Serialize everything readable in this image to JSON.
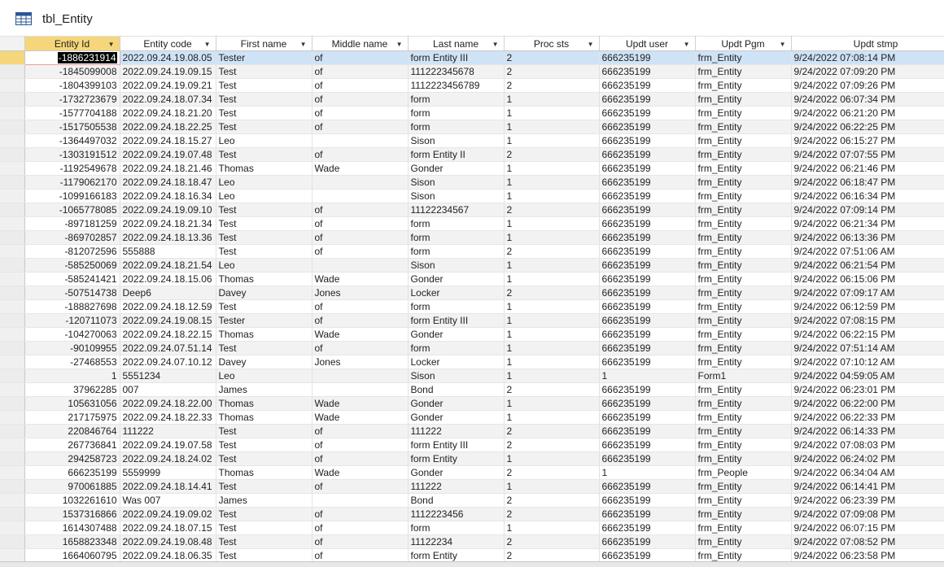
{
  "tab": {
    "title": "tbl_Entity",
    "icon": "table-icon"
  },
  "columns": [
    {
      "key": "id",
      "label": "Entity Id",
      "sorted": true
    },
    {
      "key": "code",
      "label": "Entity code"
    },
    {
      "key": "first",
      "label": "First name"
    },
    {
      "key": "middle",
      "label": "Middle name"
    },
    {
      "key": "last",
      "label": "Last name"
    },
    {
      "key": "sts",
      "label": "Proc sts"
    },
    {
      "key": "user",
      "label": "Updt user"
    },
    {
      "key": "pgm",
      "label": "Updt Pgm"
    },
    {
      "key": "stmp",
      "label": "Updt stmp",
      "noArrow": true
    }
  ],
  "rows": [
    [
      "-1886231914",
      "2022.09.24.19.08.05",
      "Tester",
      "of",
      "form Entity III",
      "2",
      "666235199",
      "frm_Entity",
      "9/24/2022 07:08:14 PM"
    ],
    [
      "-1845099008",
      "2022.09.24.19.09.15",
      "Test",
      "of",
      "111222345678",
      "2",
      "666235199",
      "frm_Entity",
      "9/24/2022 07:09:20 PM"
    ],
    [
      "-1804399103",
      "2022.09.24.19.09.21",
      "Test",
      "of",
      "1112223456789",
      "2",
      "666235199",
      "frm_Entity",
      "9/24/2022 07:09:26 PM"
    ],
    [
      "-1732723679",
      "2022.09.24.18.07.34",
      "Test",
      "of",
      "form",
      "1",
      "666235199",
      "frm_Entity",
      "9/24/2022 06:07:34 PM"
    ],
    [
      "-1577704188",
      "2022.09.24.18.21.20",
      "Test",
      "of",
      "form",
      "1",
      "666235199",
      "frm_Entity",
      "9/24/2022 06:21:20 PM"
    ],
    [
      "-1517505538",
      "2022.09.24.18.22.25",
      "Test",
      "of",
      "form",
      "1",
      "666235199",
      "frm_Entity",
      "9/24/2022 06:22:25 PM"
    ],
    [
      "-1364497032",
      "2022.09.24.18.15.27",
      "Leo",
      "",
      "Sison",
      "1",
      "666235199",
      "frm_Entity",
      "9/24/2022 06:15:27 PM"
    ],
    [
      "-1303191512",
      "2022.09.24.19.07.48",
      "Test",
      "of",
      "form Entity II",
      "2",
      "666235199",
      "frm_Entity",
      "9/24/2022 07:07:55 PM"
    ],
    [
      "-1192549678",
      "2022.09.24.18.21.46",
      "Thomas",
      "Wade",
      "Gonder",
      "1",
      "666235199",
      "frm_Entity",
      "9/24/2022 06:21:46 PM"
    ],
    [
      "-1179062170",
      "2022.09.24.18.18.47",
      "Leo",
      "",
      "Sison",
      "1",
      "666235199",
      "frm_Entity",
      "9/24/2022 06:18:47 PM"
    ],
    [
      "-1099166183",
      "2022.09.24.18.16.34",
      "Leo",
      "",
      "Sison",
      "1",
      "666235199",
      "frm_Entity",
      "9/24/2022 06:16:34 PM"
    ],
    [
      "-1065778085",
      "2022.09.24.19.09.10",
      "Test",
      "of",
      "11122234567",
      "2",
      "666235199",
      "frm_Entity",
      "9/24/2022 07:09:14 PM"
    ],
    [
      "-897181259",
      "2022.09.24.18.21.34",
      "Test",
      "of",
      "form",
      "1",
      "666235199",
      "frm_Entity",
      "9/24/2022 06:21:34 PM"
    ],
    [
      "-869702857",
      "2022.09.24.18.13.36",
      "Test",
      "of",
      "form",
      "1",
      "666235199",
      "frm_Entity",
      "9/24/2022 06:13:36 PM"
    ],
    [
      "-812072596",
      "555888",
      "Test",
      "of",
      "form",
      "2",
      "666235199",
      "frm_Entity",
      "9/24/2022 07:51:06 AM"
    ],
    [
      "-585250069",
      "2022.09.24.18.21.54",
      "Leo",
      "",
      "Sison",
      "1",
      "666235199",
      "frm_Entity",
      "9/24/2022 06:21:54 PM"
    ],
    [
      "-585241421",
      "2022.09.24.18.15.06",
      "Thomas",
      "Wade",
      "Gonder",
      "1",
      "666235199",
      "frm_Entity",
      "9/24/2022 06:15:06 PM"
    ],
    [
      "-507514738",
      "Deep6",
      "Davey",
      "Jones",
      "Locker",
      "2",
      "666235199",
      "frm_Entity",
      "9/24/2022 07:09:17 AM"
    ],
    [
      "-188827698",
      "2022.09.24.18.12.59",
      "Test",
      "of",
      "form",
      "1",
      "666235199",
      "frm_Entity",
      "9/24/2022 06:12:59 PM"
    ],
    [
      "-120711073",
      "2022.09.24.19.08.15",
      "Tester",
      "of",
      "form Entity III",
      "1",
      "666235199",
      "frm_Entity",
      "9/24/2022 07:08:15 PM"
    ],
    [
      "-104270063",
      "2022.09.24.18.22.15",
      "Thomas",
      "Wade",
      "Gonder",
      "1",
      "666235199",
      "frm_Entity",
      "9/24/2022 06:22:15 PM"
    ],
    [
      "-90109955",
      "2022.09.24.07.51.14",
      "Test",
      "of",
      "form",
      "1",
      "666235199",
      "frm_Entity",
      "9/24/2022 07:51:14 AM"
    ],
    [
      "-27468553",
      "2022.09.24.07.10.12",
      "Davey",
      "Jones",
      "Locker",
      "1",
      "666235199",
      "frm_Entity",
      "9/24/2022 07:10:12 AM"
    ],
    [
      "1",
      "5551234",
      "Leo",
      "",
      "Sison",
      "1",
      "1",
      "Form1",
      "9/24/2022 04:59:05 AM"
    ],
    [
      "37962285",
      "007",
      "James",
      "",
      "Bond",
      "2",
      "666235199",
      "frm_Entity",
      "9/24/2022 06:23:01 PM"
    ],
    [
      "105631056",
      "2022.09.24.18.22.00",
      "Thomas",
      "Wade",
      "Gonder",
      "1",
      "666235199",
      "frm_Entity",
      "9/24/2022 06:22:00 PM"
    ],
    [
      "217175975",
      "2022.09.24.18.22.33",
      "Thomas",
      "Wade",
      "Gonder",
      "1",
      "666235199",
      "frm_Entity",
      "9/24/2022 06:22:33 PM"
    ],
    [
      "220846764",
      "111222",
      "Test",
      "of",
      "111222",
      "2",
      "666235199",
      "frm_Entity",
      "9/24/2022 06:14:33 PM"
    ],
    [
      "267736841",
      "2022.09.24.19.07.58",
      "Test",
      "of",
      "form Entity III",
      "2",
      "666235199",
      "frm_Entity",
      "9/24/2022 07:08:03 PM"
    ],
    [
      "294258723",
      "2022.09.24.18.24.02",
      "Test",
      "of",
      "form Entity",
      "1",
      "666235199",
      "frm_Entity",
      "9/24/2022 06:24:02 PM"
    ],
    [
      "666235199",
      "5559999",
      "Thomas",
      "Wade",
      "Gonder",
      "2",
      "1",
      "frm_People",
      "9/24/2022 06:34:04 AM"
    ],
    [
      "970061885",
      "2022.09.24.18.14.41",
      "Test",
      "of",
      "111222",
      "1",
      "666235199",
      "frm_Entity",
      "9/24/2022 06:14:41 PM"
    ],
    [
      "1032261610",
      "Was 007",
      "James",
      "",
      "Bond",
      "2",
      "666235199",
      "frm_Entity",
      "9/24/2022 06:23:39 PM"
    ],
    [
      "1537316866",
      "2022.09.24.19.09.02",
      "Test",
      "of",
      "1112223456",
      "2",
      "666235199",
      "frm_Entity",
      "9/24/2022 07:09:08 PM"
    ],
    [
      "1614307488",
      "2022.09.24.18.07.15",
      "Test",
      "of",
      "form",
      "1",
      "666235199",
      "frm_Entity",
      "9/24/2022 06:07:15 PM"
    ],
    [
      "1658823348",
      "2022.09.24.19.08.48",
      "Test",
      "of",
      "11122234",
      "2",
      "666235199",
      "frm_Entity",
      "9/24/2022 07:08:52 PM"
    ],
    [
      "1664060795",
      "2022.09.24.18.06.35",
      "Test",
      "of",
      "form Entity",
      "2",
      "666235199",
      "frm_Entity",
      "9/24/2022 06:23:58 PM"
    ]
  ],
  "colors": {
    "sorted_header": "#f6d67a",
    "current_row": "#cfe3f6",
    "alt_row": "#f2f2f2"
  }
}
